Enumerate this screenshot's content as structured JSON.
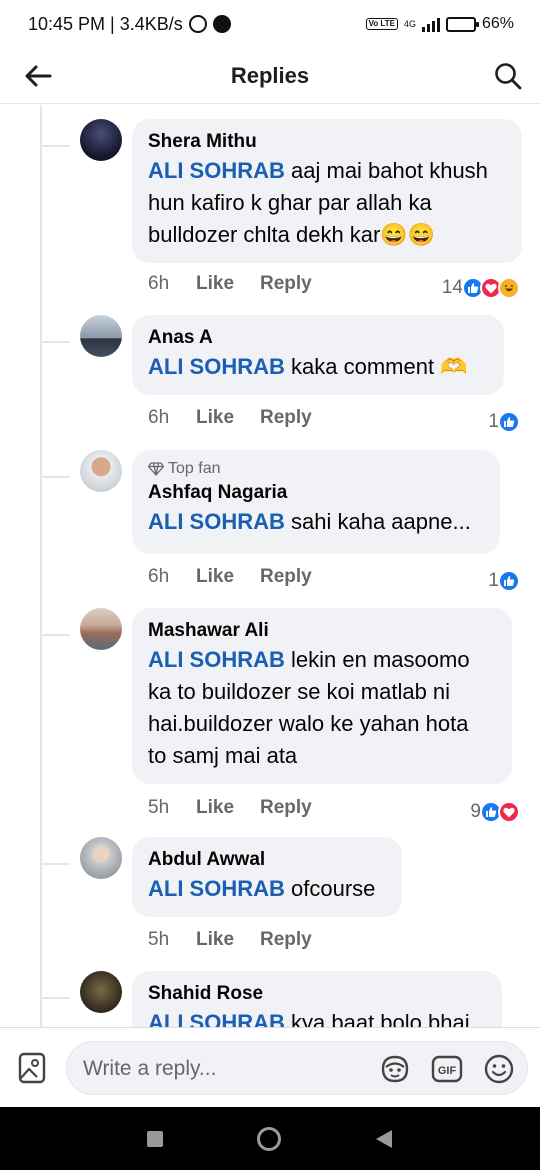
{
  "status": {
    "time_speed": "10:45 PM | 3.4KB/s",
    "network": "4G",
    "volte": "Vo LTE",
    "battery": "66%",
    "battery_level": 0.66
  },
  "header": {
    "title": "Replies"
  },
  "comments": [
    {
      "author": "Shera Mithu",
      "mention": "ALI SOHRAB",
      "lines": [
        "aaj mai bahot khush",
        "hun kafiro k ghar par allah ka",
        "bulldozer chlta dekh kar😄😄"
      ],
      "time": "6h",
      "like": "Like",
      "reply": "Reply",
      "reaction_count": "14",
      "reactions": [
        "like",
        "love",
        "haha"
      ]
    },
    {
      "author": "Anas A",
      "mention": "ALI SOHRAB",
      "lines": [
        "kaka comment 🫶"
      ],
      "time": "6h",
      "like": "Like",
      "reply": "Reply",
      "reaction_count": "1",
      "reactions": [
        "like"
      ]
    },
    {
      "badge": "Top fan",
      "author": "Ashfaq Nagaria",
      "mention": "ALI SOHRAB",
      "lines": [
        "sahi kaha aapne..."
      ],
      "time": "6h",
      "like": "Like",
      "reply": "Reply",
      "reaction_count": "1",
      "reactions": [
        "like"
      ]
    },
    {
      "author": "Mashawar Ali",
      "mention": "ALI SOHRAB",
      "lines": [
        "lekin en masoomo",
        "ka to buildozer se koi matlab ni",
        "hai.buildozer walo ke yahan hota",
        "to samj mai ata"
      ],
      "time": "5h",
      "like": "Like",
      "reply": "Reply",
      "reaction_count": "9",
      "reactions": [
        "like",
        "love"
      ]
    },
    {
      "author": "Abdul Awwal",
      "mention": "ALI SOHRAB",
      "lines": [
        "ofcourse"
      ],
      "time": "5h",
      "like": "Like",
      "reply": "Reply",
      "reaction_count": "",
      "reactions": []
    },
    {
      "author": "Shahid Rose",
      "mention": "ALI SOHRAB",
      "lines": [
        "kya baat bolo bhai"
      ],
      "time": "",
      "like": "",
      "reply": "",
      "reaction_count": "",
      "reactions": []
    }
  ],
  "reply_bar": {
    "placeholder": "Write a reply..."
  },
  "icons": {
    "back": "arrow-left-icon",
    "search": "search-icon",
    "photo": "photo-icon",
    "avatar_sticker": "avatar-sticker-icon",
    "gif": "gif-icon",
    "emoji": "emoji-icon"
  },
  "colors": {
    "mention": "#1a5fb4",
    "bubble": "#f0f2f5",
    "like_reaction": "#1877f2",
    "love_reaction": "#f02849",
    "haha_reaction": "#f7b125"
  }
}
